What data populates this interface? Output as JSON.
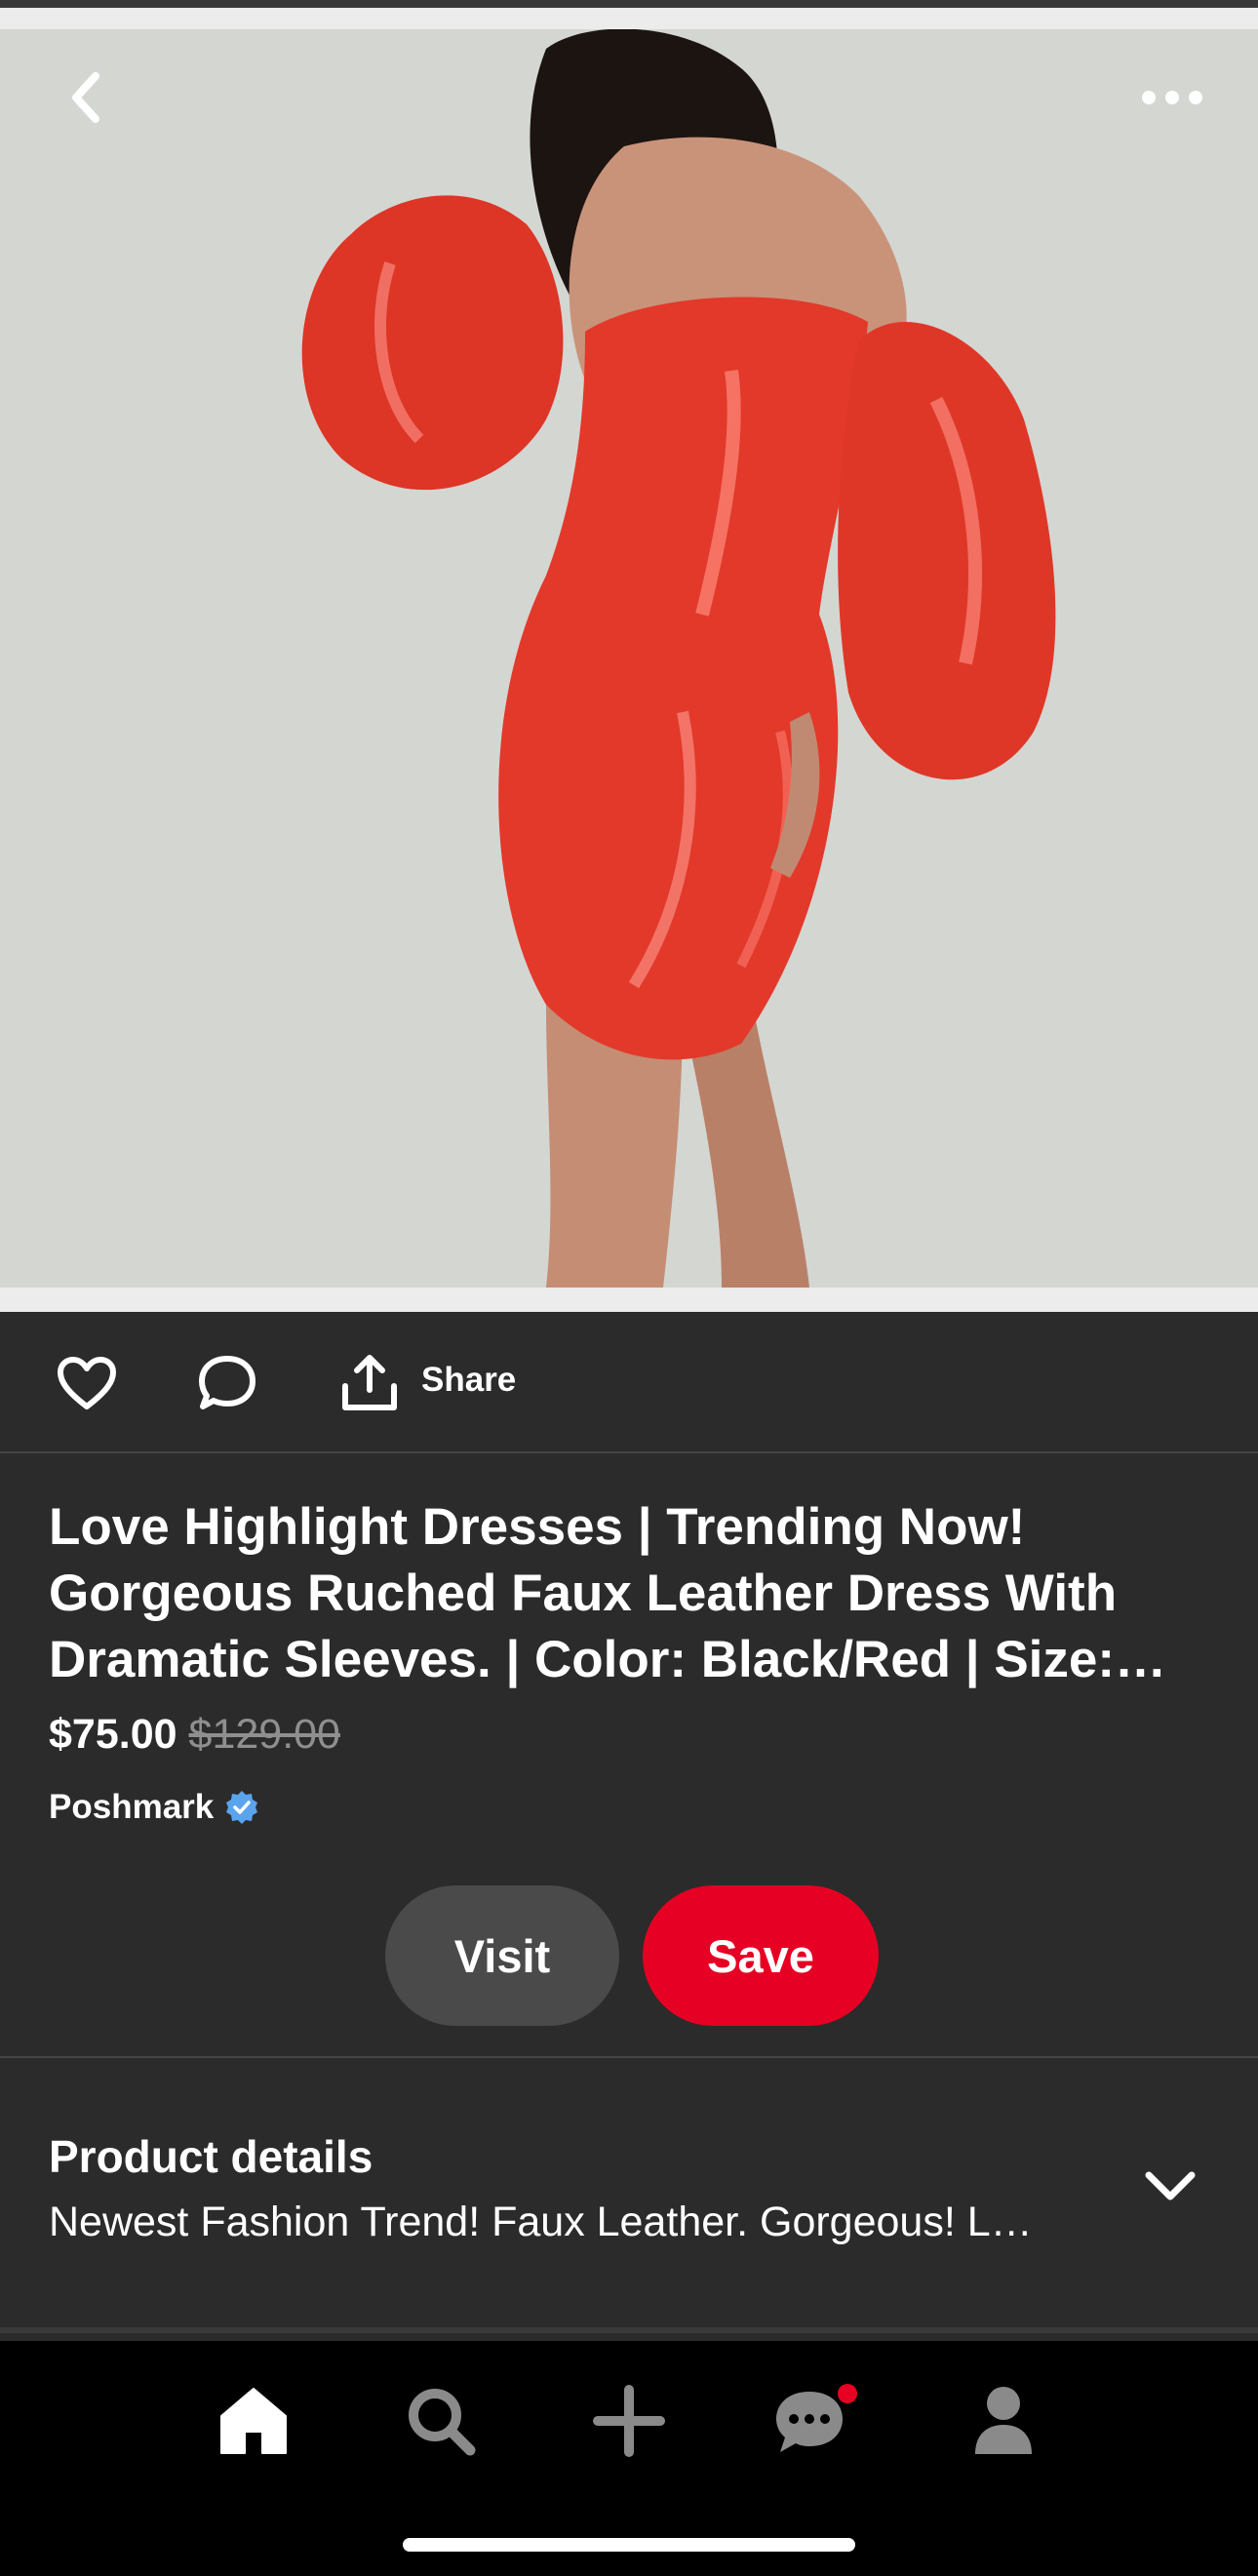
{
  "header": {
    "back_icon": "chevron-left-icon",
    "more_icon": "ellipsis-icon"
  },
  "actions": {
    "like_icon": "heart-icon",
    "comment_icon": "comment-icon",
    "share_icon": "share-icon",
    "share_label": "Share"
  },
  "product": {
    "title_lines": [
      "Love Highlight Dresses | Trending Now!",
      "Gorgeous Ruched Faux Leather Dress With",
      "Dramatic Sleeves. | Color: Black/Red | Size:…"
    ],
    "price": "$75.00",
    "original_price": "$129.00",
    "merchant": "Poshmark",
    "verified_icon": "verified-badge-icon"
  },
  "buttons": {
    "visit_label": "Visit",
    "save_label": "Save"
  },
  "details": {
    "title": "Product details",
    "description": "Newest Fashion Trend! Faux Leather. Gorgeous! L…",
    "expand_icon": "chevron-down-icon"
  },
  "nav": {
    "items": [
      "home-icon",
      "search-icon",
      "plus-icon",
      "messages-icon",
      "profile-icon"
    ],
    "messages_has_notification": true
  },
  "colors": {
    "background": "#2b2b2b",
    "save_red": "#e60023",
    "visit_gray": "#4a4a4a",
    "nav_bg": "#000000",
    "notification_dot": "#e60023"
  }
}
